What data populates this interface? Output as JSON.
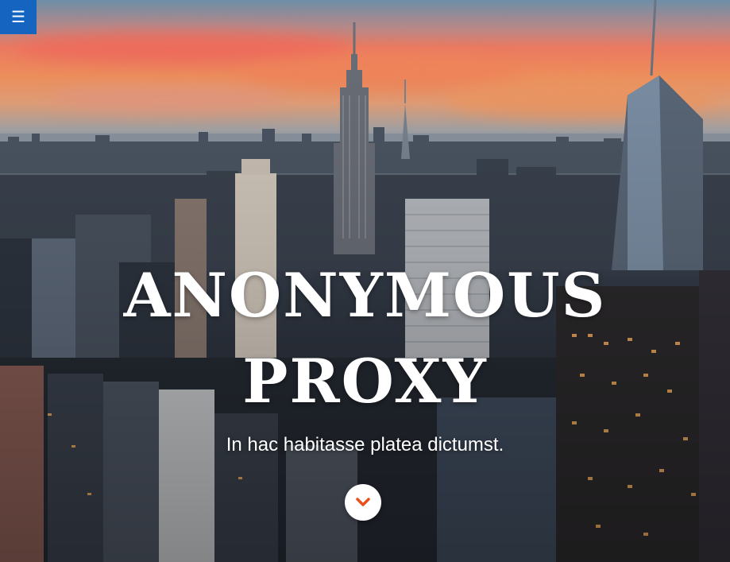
{
  "nav": {
    "menu_icon": "hamburger-menu-icon",
    "menu_glyph": "☰",
    "menu_color": "#1565c0"
  },
  "hero": {
    "title_line1": "ANONYMOUS",
    "title_line2": "PROXY",
    "subtitle": "In hac habitasse platea dictumst.",
    "scroll_icon": "chevron-down-icon",
    "accent_color": "#e8501c",
    "background_image": "city-skyline-at-sunset"
  }
}
